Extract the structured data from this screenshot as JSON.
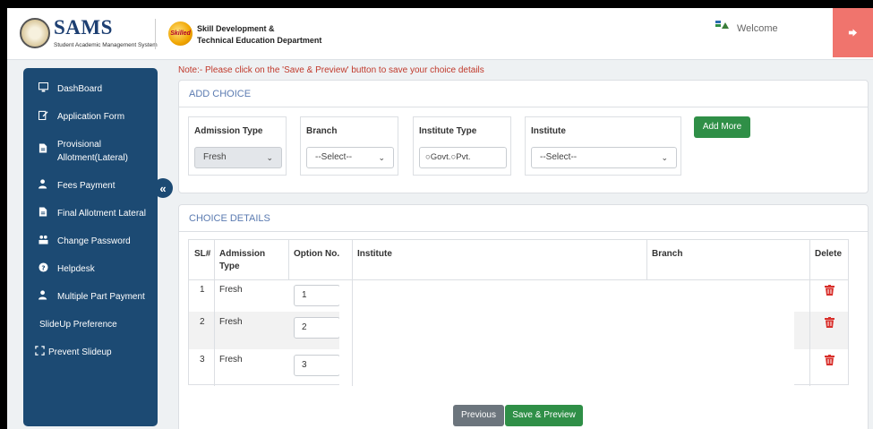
{
  "header": {
    "app_name": "SAMS",
    "app_subtitle": "Student Academic Management System",
    "dept_logo_text": "Skilled in ODISHA",
    "dept_line1": "Skill Development &",
    "dept_line2": "Technical Education Department",
    "welcome": "Welcome"
  },
  "sidebar": {
    "items": [
      {
        "label": "DashBoard",
        "icon": "monitor-icon"
      },
      {
        "label": "Application Form",
        "icon": "edit-form-icon"
      },
      {
        "label": "Provisional Allotment(Lateral)",
        "icon": "document-icon"
      },
      {
        "label": "Fees Payment",
        "icon": "user-payment-icon"
      },
      {
        "label": "Final Allotment Lateral",
        "icon": "document-icon"
      },
      {
        "label": "Change Password",
        "icon": "users-icon"
      },
      {
        "label": "Helpdesk",
        "icon": "help-icon"
      },
      {
        "label": "Multiple Part Payment",
        "icon": "user-payment-icon"
      },
      {
        "label": "SlideUp Preference",
        "icon": ""
      },
      {
        "label": "Prevent Slideup",
        "icon": "expand-icon"
      }
    ],
    "collapse_glyph": "«"
  },
  "note": "Note:- Please click on the 'Save & Preview' button to save your choice details",
  "add_choice": {
    "title": "ADD CHOICE",
    "admission_type": {
      "label": "Admission Type",
      "value": "Fresh"
    },
    "branch": {
      "label": "Branch",
      "value": "--Select--"
    },
    "institute_type": {
      "label": "Institute Type",
      "option_govt": "Govt.",
      "option_pvt": "Pvt."
    },
    "institute": {
      "label": "Institute",
      "value": "--Select--"
    },
    "add_more": "Add More"
  },
  "choice_details": {
    "title": "CHOICE DETAILS",
    "columns": {
      "sl": "SL#",
      "admission_type": "Admission Type",
      "option_no": "Option No.",
      "institute": "Institute",
      "branch": "Branch",
      "delete": "Delete"
    },
    "rows": [
      {
        "sl": "1",
        "admission_type": "Fresh",
        "option_no": "1"
      },
      {
        "sl": "2",
        "admission_type": "Fresh",
        "option_no": "2"
      },
      {
        "sl": "3",
        "admission_type": "Fresh",
        "option_no": "3"
      }
    ]
  },
  "footer": {
    "previous": "Previous",
    "save_preview": "Save & Preview"
  },
  "colors": {
    "sidebar": "#1c4a73",
    "accent_green": "#2f8f47",
    "logout": "#f0746d",
    "note_red": "#c0392b",
    "delete_red": "#d9302c"
  }
}
